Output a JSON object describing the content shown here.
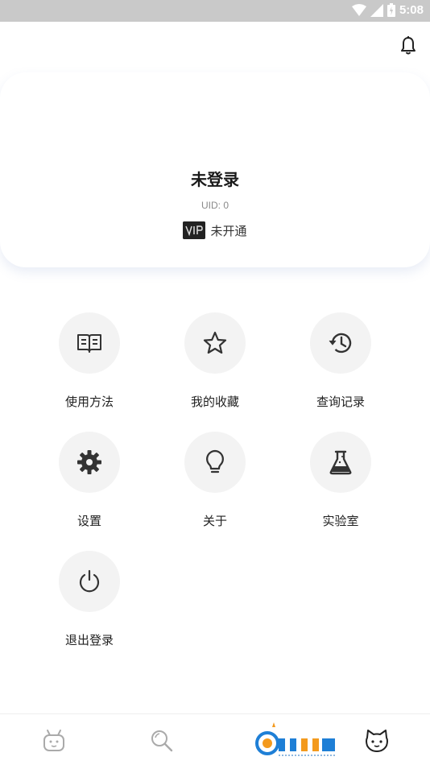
{
  "status_bar": {
    "time": "5:08"
  },
  "profile": {
    "username": "未登录",
    "uid_label": "UID:",
    "uid_value": "0",
    "vip_status": "未开通"
  },
  "menu": [
    {
      "label": "使用方法",
      "icon": "book-icon"
    },
    {
      "label": "我的收藏",
      "icon": "star-icon"
    },
    {
      "label": "查询记录",
      "icon": "history-icon"
    },
    {
      "label": "设置",
      "icon": "gear-icon"
    },
    {
      "label": "关于",
      "icon": "lightbulb-icon"
    },
    {
      "label": "实验室",
      "icon": "flask-icon"
    },
    {
      "label": "退出登录",
      "icon": "power-icon"
    }
  ],
  "bottom_nav": [
    {
      "icon": "robot-icon"
    },
    {
      "icon": "search-icon"
    },
    {
      "icon": "gogo-logo"
    },
    {
      "icon": "cat-icon"
    }
  ],
  "colors": {
    "status_bar": "#c9c9c9",
    "circle_bg": "#f3f3f3",
    "icon": "#333333",
    "watermark_blue": "#1e7fd6",
    "watermark_orange": "#f39a1e"
  }
}
